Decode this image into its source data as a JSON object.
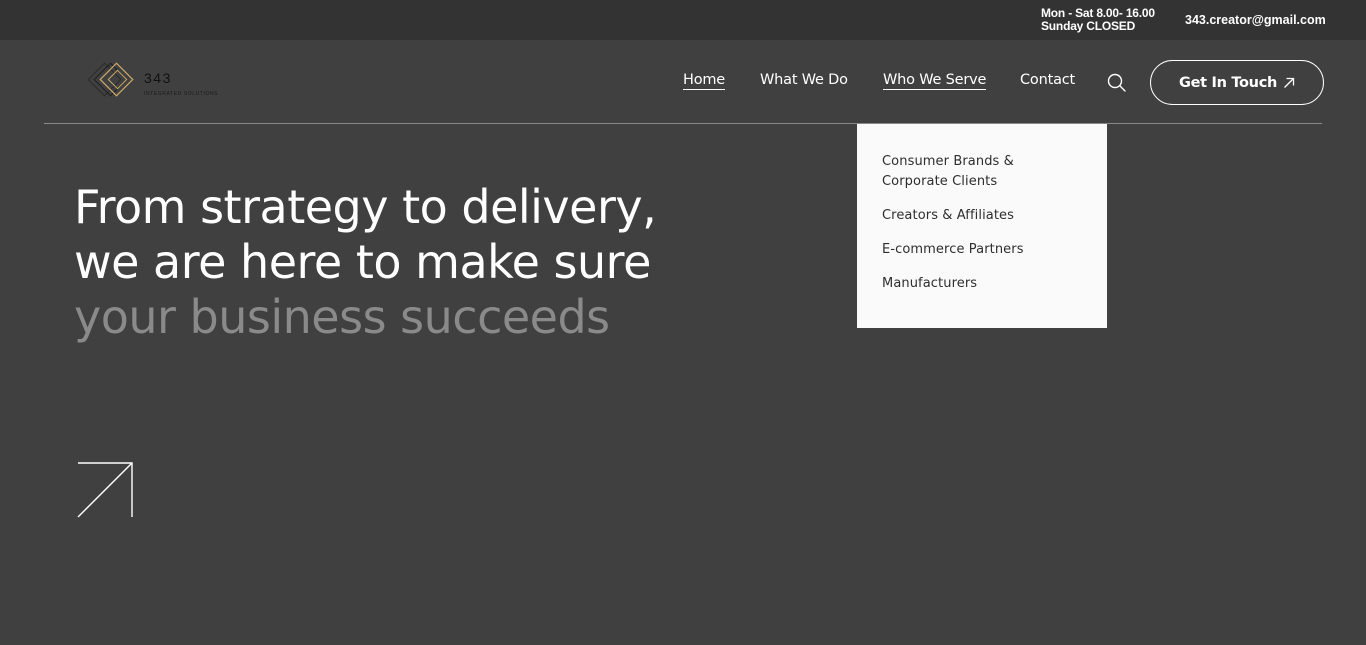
{
  "topbar": {
    "hours_line1": "Mon - Sat 8.00- 16.00",
    "hours_line2": "Sunday CLOSED",
    "email": "343.creator@gmail.com"
  },
  "logo": {
    "number": "343",
    "tagline": "INTEGRATED SOLUTIONS"
  },
  "nav": {
    "items": [
      {
        "label": "Home"
      },
      {
        "label": "What We Do"
      },
      {
        "label": "Who We Serve"
      },
      {
        "label": "Contact"
      }
    ],
    "search_icon": "search-icon",
    "cta_label": "Get In Touch",
    "cta_icon": "arrow-up-right-icon"
  },
  "dropdown": {
    "items": [
      {
        "label": "Consumer Brands & Corporate Clients"
      },
      {
        "label": "Creators & Affiliates"
      },
      {
        "label": "E-commerce Partners"
      },
      {
        "label": "Manufacturers"
      }
    ]
  },
  "hero": {
    "line1": "From strategy to delivery,",
    "line2": "we are here to make sure",
    "line3": "your business succeeds",
    "arrow_icon": "arrow-up-right-icon"
  },
  "colors": {
    "background": "#404040",
    "topbar": "#333333",
    "muted_text": "#8a8a8a",
    "dropdown_bg": "#fafafa",
    "logo_gold": "#c9a76a"
  }
}
